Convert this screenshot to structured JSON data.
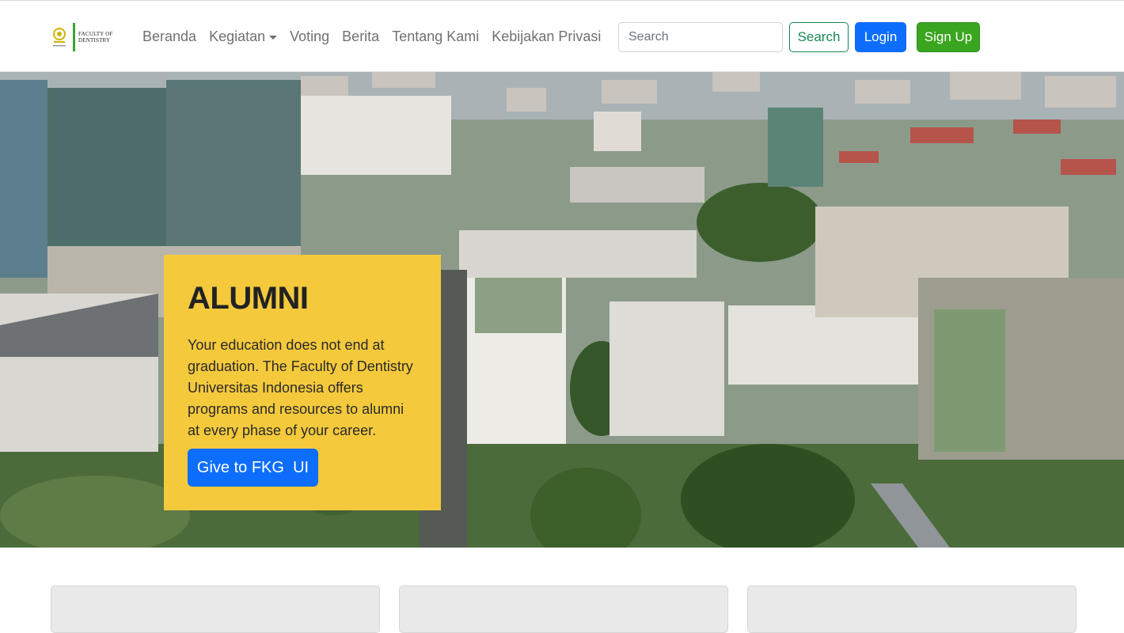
{
  "brand": {
    "logo_text_line1": "FACULTY OF",
    "logo_text_line2": "DENTISTRY",
    "logo_icon": "ui-emblem-icon"
  },
  "nav": {
    "items": [
      {
        "label": "Beranda"
      },
      {
        "label": "Kegiatan",
        "dropdown": true
      },
      {
        "label": "Voting"
      },
      {
        "label": "Berita"
      },
      {
        "label": "Tentang Kami"
      },
      {
        "label": "Kebijakan Privasi"
      }
    ]
  },
  "search": {
    "placeholder": "Search",
    "button_label": "Search"
  },
  "auth": {
    "login_label": "Login",
    "signup_label": "Sign Up"
  },
  "hero": {
    "title": "ALUMNI",
    "description": "Your education does not end at graduation. The Faculty of Dentistry Universitas Indonesia offers programs and resources to alumni at every phase of your career.",
    "cta_label": "Give to FKG  UI"
  },
  "colors": {
    "card_bg": "#f4c93c",
    "primary": "#0d6efd",
    "success": "#198754",
    "signup": "#3aa51e"
  }
}
